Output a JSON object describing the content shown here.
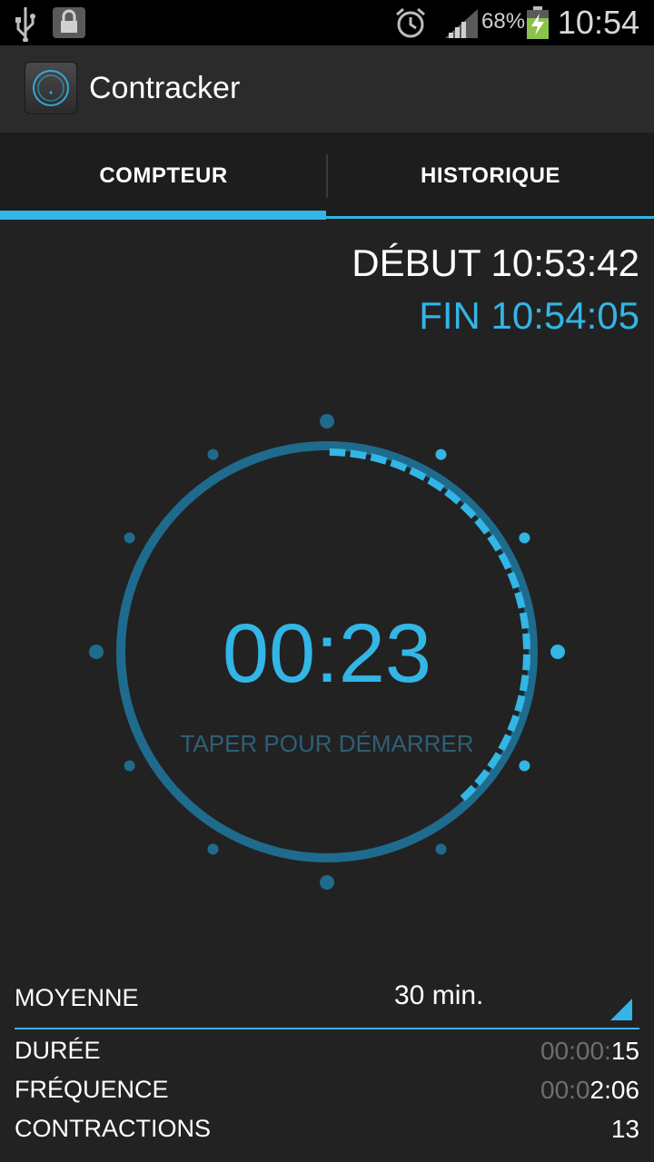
{
  "status_bar": {
    "battery_percent": "68%",
    "time": "10:54",
    "icons": [
      "usb-icon",
      "lock-icon",
      "alarm-icon",
      "signal-icon",
      "battery-charging-icon"
    ]
  },
  "app": {
    "title": "Contracker",
    "logo_icon": "contracker-logo-icon"
  },
  "tabs": [
    {
      "label": "COMPTEUR",
      "selected": true
    },
    {
      "label": "HISTORIQUE",
      "selected": false
    }
  ],
  "session": {
    "start": "DÉBUT 10:53:42",
    "end": "FIN 10:54:05"
  },
  "timer": {
    "value": "00:23",
    "hint": "TAPER POUR DÉMARRER",
    "elapsed_seconds": 23,
    "cycle_seconds": 60
  },
  "stats": {
    "label": "MOYENNE",
    "period": "30 min.",
    "rows": [
      {
        "label": "DURÉE",
        "value_dim": "00:00:",
        "value": "15"
      },
      {
        "label": "FRÉQUENCE",
        "value_dim": "00:0",
        "value": "2:06"
      },
      {
        "label": "CONTRACTIONS",
        "value_dim": "",
        "value": "13"
      }
    ]
  },
  "colors": {
    "accent": "#33b5e5",
    "ring": "#1f6b8e",
    "background": "#222222"
  }
}
